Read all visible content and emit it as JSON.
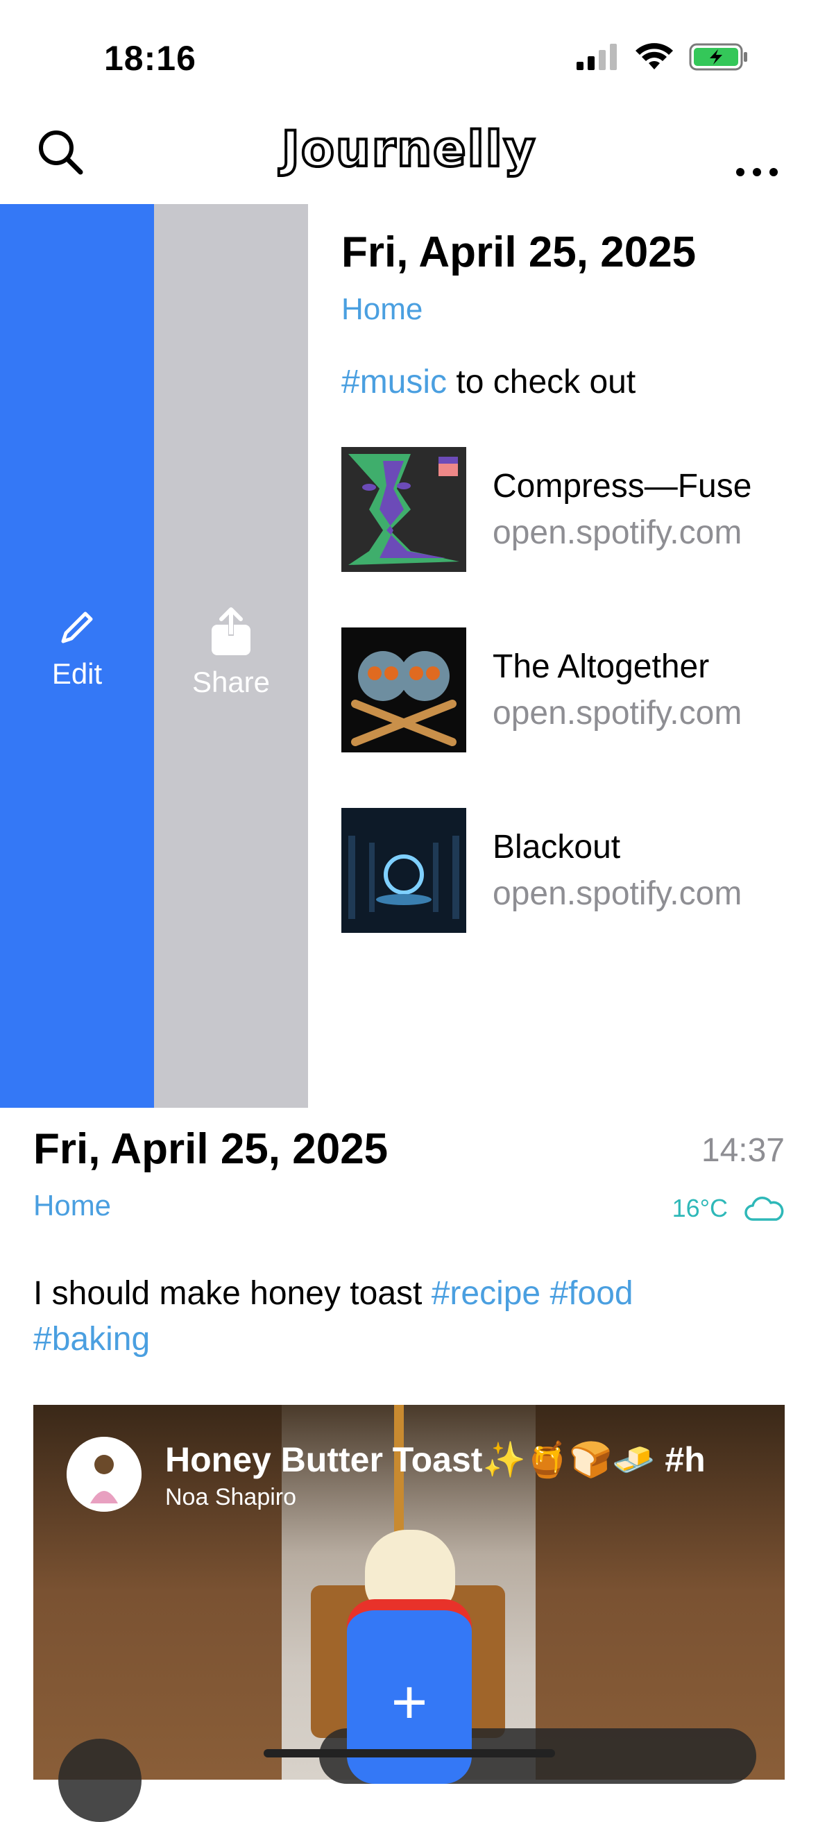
{
  "status_bar": {
    "time": "18:16"
  },
  "navbar": {
    "title": "Journelly"
  },
  "swipe_actions": {
    "edit_label": "Edit",
    "share_label": "Share"
  },
  "entry1": {
    "date": "Fri, April 25, 2025",
    "location": "Home",
    "text_tag": "#music",
    "text_rest": " to check out",
    "links": [
      {
        "title": "Compress—Fuse",
        "url": "open.spotify.com"
      },
      {
        "title": "The Altogether",
        "url": "open.spotify.com"
      },
      {
        "title": "Blackout",
        "url": "open.spotify.com"
      }
    ]
  },
  "entry2": {
    "date": "Fri, April 25, 2025",
    "time": "14:37",
    "location": "Home",
    "temperature": "16°C",
    "text_plain": "I should make honey toast ",
    "tag1": "#recipe",
    "tag2": "#food",
    "tag3": "#baking"
  },
  "video": {
    "title": "Honey Butter Toast✨🍯🍞🧈 #h",
    "author": "Noa Shapiro"
  },
  "colors": {
    "accent_blue": "#3478F6",
    "tag_blue": "#4A9FE0",
    "share_gray": "#C7C7CC",
    "weather_teal": "#2EB8B8"
  }
}
